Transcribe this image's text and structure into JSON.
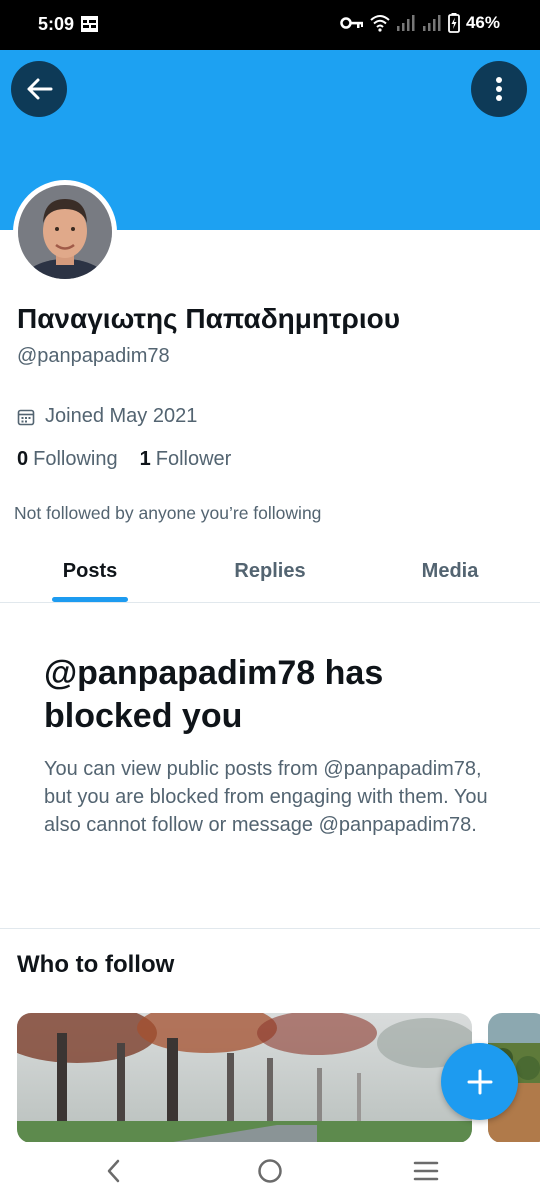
{
  "status_bar": {
    "time": "5:09",
    "battery": "46%",
    "icons": [
      "grid-icon",
      "key-icon",
      "wifi-icon",
      "signal-icon",
      "signal-icon",
      "battery-charging-icon"
    ]
  },
  "header": {
    "back_icon": "arrow-left-icon",
    "more_icon": "more-vertical-icon",
    "banner_color": "#1da1f2"
  },
  "profile": {
    "display_name": "Παναγιωτης Παπαδημητριου",
    "handle": "@panpapadim78",
    "joined": "Joined May 2021",
    "following_count": "0",
    "following_label": "Following",
    "followers_count": "1",
    "followers_label": "Follower",
    "not_followed_note": "Not followed by anyone you’re following"
  },
  "tabs": [
    {
      "label": "Posts",
      "active": true
    },
    {
      "label": "Replies",
      "active": false
    },
    {
      "label": "Media",
      "active": false
    }
  ],
  "blocked": {
    "title": "@panpapadim78 has blocked you",
    "body": "You can view public posts from @panpapadim78, but you are blocked from engaging with them. You also cannot follow or message @panpapadim78."
  },
  "who_to_follow": {
    "title": "Who to follow"
  },
  "fab_icon": "plus-icon",
  "colors": {
    "accent": "#1d9bf0",
    "text_primary": "#0f1419",
    "text_secondary": "#536471"
  }
}
